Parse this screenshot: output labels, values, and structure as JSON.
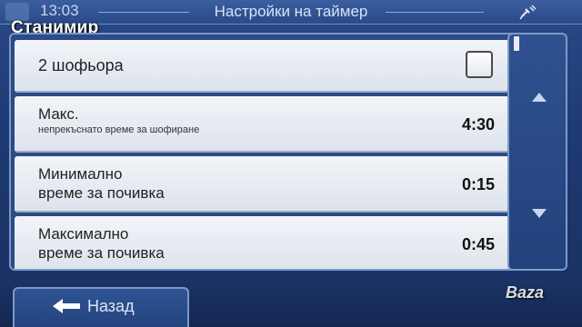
{
  "status": {
    "time": "13:03",
    "title": "Настройки на таймер",
    "gps_icon": "satellite-icon"
  },
  "overlay": {
    "name": "Станимир"
  },
  "settings": [
    {
      "label": "2 шофьора",
      "type": "checkbox",
      "checked": false
    },
    {
      "label_line1": "Макс.",
      "label_line2": "непрекъснато време за шофиране",
      "value": "4:30"
    },
    {
      "label_line1": "Минимално",
      "label_line2": "време за почивка",
      "value": "0:15"
    },
    {
      "label_line1": "Максимално",
      "label_line2": "време за почивка",
      "value": "0:45"
    }
  ],
  "scroll": {
    "up_icon": "arrow-up-icon",
    "down_icon": "arrow-down-icon"
  },
  "footer": {
    "back_label": "Назад",
    "back_icon": "arrow-left-icon"
  },
  "watermark": "Baza"
}
